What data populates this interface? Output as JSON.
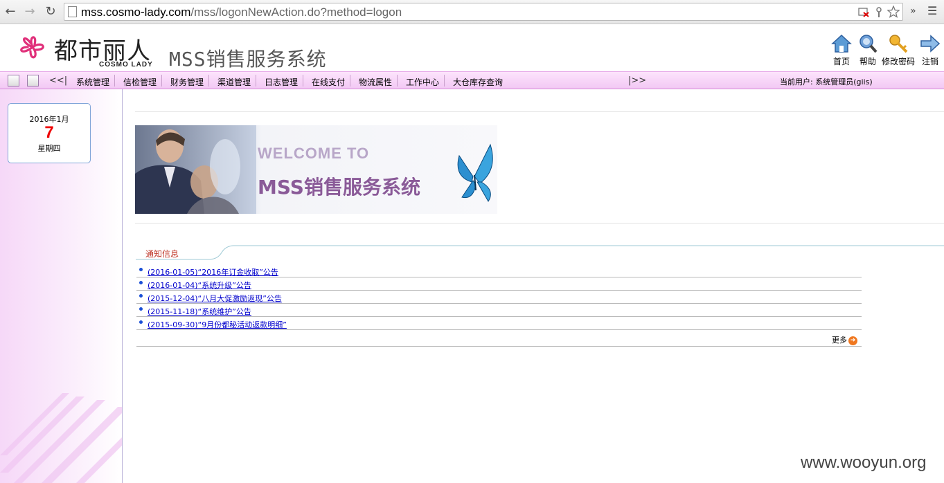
{
  "browser": {
    "url_host": "mss.cosmo-lady.com",
    "url_path": "/mss/logonNewAction.do?method=logon",
    "menu_icon": "☰",
    "extend_icon": "»"
  },
  "header": {
    "logo_cn": "都市丽人",
    "logo_en": "COSMO LADY",
    "system_title": "MSS销售服务系统",
    "tools": [
      {
        "label": "首页",
        "icon": "home-icon"
      },
      {
        "label": "帮助",
        "icon": "help-icon"
      },
      {
        "label": "修改密码",
        "icon": "key-icon"
      },
      {
        "label": "注销",
        "icon": "logout-icon"
      }
    ]
  },
  "menu": {
    "left_arrow": "<<|",
    "right_arrow": "|>>",
    "items": [
      "系统管理",
      "信检管理",
      "财务管理",
      "渠道管理",
      "日志管理",
      "在线支付",
      "物流属性",
      "工作中心",
      "大仓库存查询"
    ],
    "current_user": "当前用户: 系统管理员(giis)"
  },
  "date": {
    "year_month": "2016年1月",
    "day": "7",
    "weekday": "星期四"
  },
  "banner": {
    "welcome": "WELCOME TO",
    "title": "MSS销售服务系统"
  },
  "notice": {
    "title": "通知信息",
    "items": [
      "(2016-01-05)“2016年订金收取”公告",
      "(2016-01-04)“系统升级”公告",
      "(2015-12-04)“八月大促激励返现”公告",
      "(2015-11-18)“系统维护”公告",
      "(2015-09-30)“9月份都秘活动返款明细”"
    ],
    "more_label": "更多"
  },
  "watermark": "www.wooyun.org",
  "colors": {
    "menu_bg": "#f2c8f4",
    "notice_title": "#c0392b",
    "link": "#0000cc",
    "date_day": "#ee0000",
    "logo_pink": "#e0307a"
  }
}
